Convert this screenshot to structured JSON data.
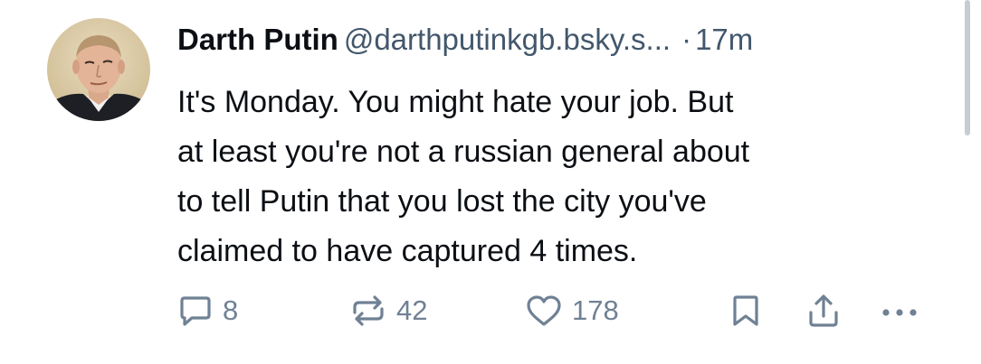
{
  "post": {
    "author": {
      "display_name": "Darth Putin",
      "handle": "@darthputinkgb.bsky.s...",
      "separator": "·",
      "timestamp": "17m"
    },
    "text_lines": [
      "It's Monday. You might hate your job. But",
      "at least you're not a russian general about",
      "to tell Putin that you lost the city you've",
      "claimed to have captured 4 times."
    ],
    "actions": {
      "replies": "8",
      "reposts": "42",
      "likes": "178"
    }
  },
  "icons": {
    "reply": "speech-bubble-icon",
    "repost": "repost-arrows-icon",
    "like": "heart-icon",
    "bookmark": "bookmark-icon",
    "share": "share-upload-icon",
    "more": "ellipsis-icon"
  },
  "colors": {
    "text": "#0b0f14",
    "muted": "#42576c",
    "action": "#6f8194"
  }
}
